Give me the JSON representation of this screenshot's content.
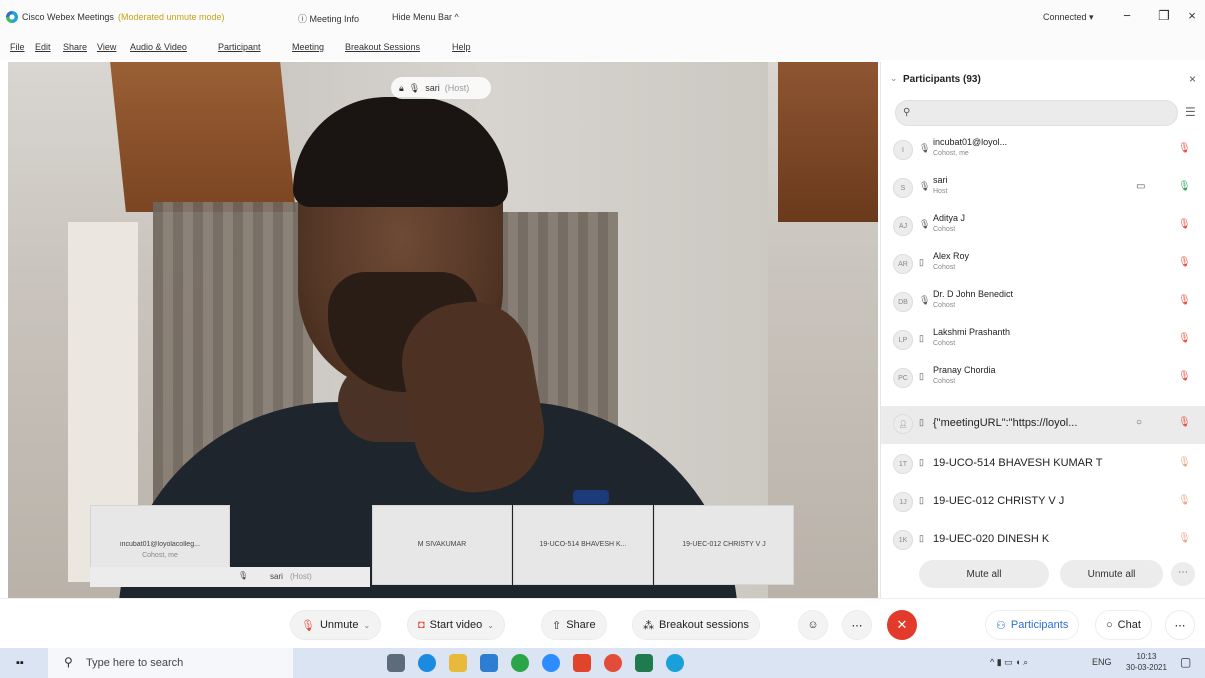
{
  "titlebar": {
    "app_title": "Cisco Webex Meetings",
    "mode": "(Moderated unmute mode)",
    "meeting_info": "Meeting Info",
    "hide_menu": "Hide Menu Bar",
    "connection": "Connected"
  },
  "menu": [
    "File",
    "Edit",
    "Share",
    "View",
    "Audio & Video",
    "Participant",
    "Meeting",
    "Breakout Sessions",
    "Help"
  ],
  "video": {
    "active_speaker": "sari",
    "active_role": "(Host)",
    "self_label": "sari",
    "self_role": "(Host)"
  },
  "thumbnails": [
    {
      "name": "incubat01@loyolacolleg...",
      "sub": "Cohost, me"
    },
    {
      "name": "M SIVAKUMAR",
      "sub": ""
    },
    {
      "name": "19-UCO-514 BHAVESH K...",
      "sub": ""
    },
    {
      "name": "19-UEC-012 CHRISTY V J",
      "sub": ""
    }
  ],
  "panel": {
    "title": "Participants (93)",
    "search_placeholder": "",
    "mute_all": "Mute all",
    "unmute_all": "Unmute all"
  },
  "participants": [
    {
      "initials": "I",
      "name": "incubat01@loyol...",
      "role": "Cohost, me"
    },
    {
      "initials": "S",
      "name": "sari",
      "role": "Host"
    },
    {
      "initials": "AJ",
      "name": "Aditya J",
      "role": "Cohost"
    },
    {
      "initials": "AR",
      "name": "Alex Roy",
      "role": "Cohost"
    },
    {
      "initials": "DB",
      "name": "Dr. D John Benedict",
      "role": "Cohost"
    },
    {
      "initials": "LP",
      "name": "Lakshmi Prashanth",
      "role": "Cohost"
    },
    {
      "initials": "PC",
      "name": "Pranay Chordia",
      "role": "Cohost"
    },
    {
      "initials": "",
      "name": "{\"meetingURL\":\"https://loyol...",
      "role": ""
    },
    {
      "initials": "1T",
      "name": "19-UCO-514 BHAVESH KUMAR T",
      "role": ""
    },
    {
      "initials": "1J",
      "name": "19-UEC-012 CHRISTY V J",
      "role": ""
    },
    {
      "initials": "1K",
      "name": "19-UEC-020 DINESH K",
      "role": ""
    }
  ],
  "controls": {
    "unmute": "Unmute",
    "start_video": "Start video",
    "share": "Share",
    "breakout": "Breakout sessions",
    "participants": "Participants",
    "chat": "Chat"
  },
  "taskbar": {
    "search_placeholder": "Type here to search",
    "lang": "ENG",
    "time": "10:13",
    "date": "30-03-2021"
  },
  "colors": {
    "accent": "#2c6fd1",
    "leave": "#e23a2b",
    "muted_mic": "#e64b3b",
    "live_mic": "#2aa05a",
    "mode_text": "#c7a316"
  }
}
